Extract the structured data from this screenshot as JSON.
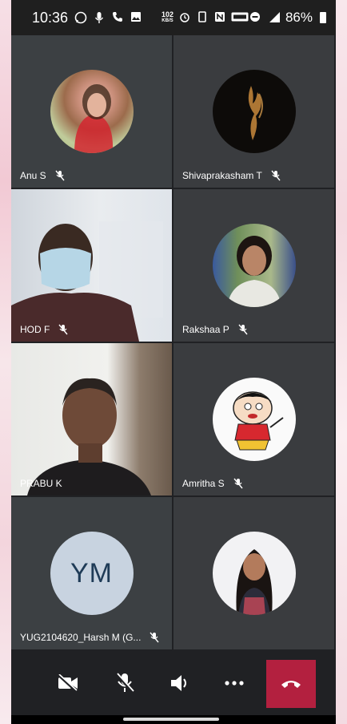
{
  "status_bar": {
    "time": "10:36",
    "speed_value": "102",
    "speed_unit": "KB/S",
    "battery": "86%"
  },
  "participants": [
    {
      "name": "Anu S",
      "muted": true,
      "tile": "avatar"
    },
    {
      "name": "Shivaprakasham T",
      "muted": true,
      "tile": "avatar"
    },
    {
      "name": "HOD F",
      "muted": true,
      "tile": "video"
    },
    {
      "name": "Rakshaa P",
      "muted": true,
      "tile": "avatar"
    },
    {
      "name": "PRABU K",
      "muted": false,
      "tile": "video"
    },
    {
      "name": "Amritha S",
      "muted": true,
      "tile": "avatar"
    },
    {
      "name": "YUG2104620_Harsh M (G...",
      "muted": true,
      "tile": "initials",
      "initials": "YM"
    },
    {
      "name": "",
      "muted": false,
      "tile": "avatar"
    }
  ],
  "controls": {
    "camera": "camera-off-icon",
    "mic": "mic-off-icon",
    "speaker": "speaker-icon",
    "more": "more-icon",
    "end_call": "end-call-icon"
  },
  "colors": {
    "tile_bg": "#3c4043",
    "end_call": "#b3203f",
    "initials_bg": "#c8d3e0",
    "initials_text": "#1f3b57"
  }
}
